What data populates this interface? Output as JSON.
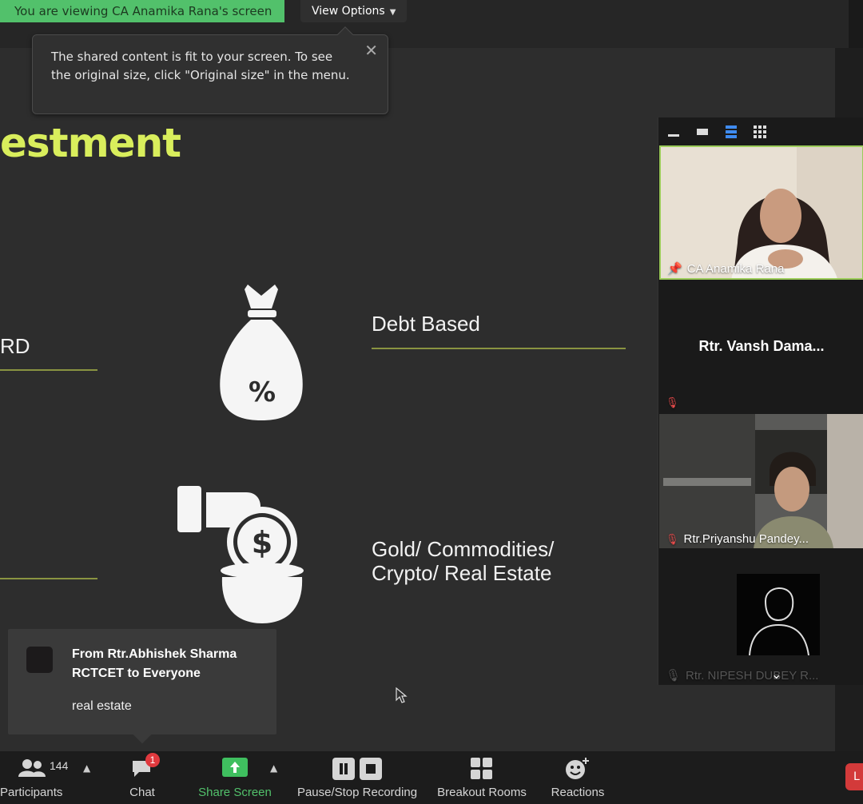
{
  "banner": {
    "viewing_text": "You are viewing CA Anamika Rana's screen",
    "view_options_label": "View Options"
  },
  "tooltip": {
    "text": "The shared content is fit to your screen. To see the original size, click \"Original size\" in the menu."
  },
  "slide": {
    "title": "estment",
    "label_left": "RD",
    "label_debt": "Debt Based",
    "label_gold_line1": "Gold/ Commodities/",
    "label_gold_line2": "Crypto/ Real Estate",
    "bag_symbol": "%",
    "coin_symbol": "$",
    "accent_color": "#d9ee5c"
  },
  "chat_toast": {
    "sender_line1": "From Rtr.Abhishek Sharma",
    "sender_line2": "RCTCET to Everyone",
    "message": "real estate"
  },
  "gallery": {
    "tiles": [
      {
        "name": "CA Anamika Rana",
        "icon": "pin-icon"
      },
      {
        "name": "Rtr. Vansh Dama...",
        "icon": "mic-off-icon"
      },
      {
        "name": "Rtr.Priyanshu Pandey...",
        "icon": "mic-off-icon"
      },
      {
        "name": "Rtr. NIPESH DUBEY R...",
        "icon": "mic-off-icon"
      }
    ]
  },
  "toolbar": {
    "participants_label": "Participants",
    "participants_count": "144",
    "chat_label": "Chat",
    "chat_badge": "1",
    "share_label": "Share Screen",
    "recording_label": "Pause/Stop Recording",
    "breakout_label": "Breakout Rooms",
    "reactions_label": "Reactions",
    "leave_label": "L"
  }
}
